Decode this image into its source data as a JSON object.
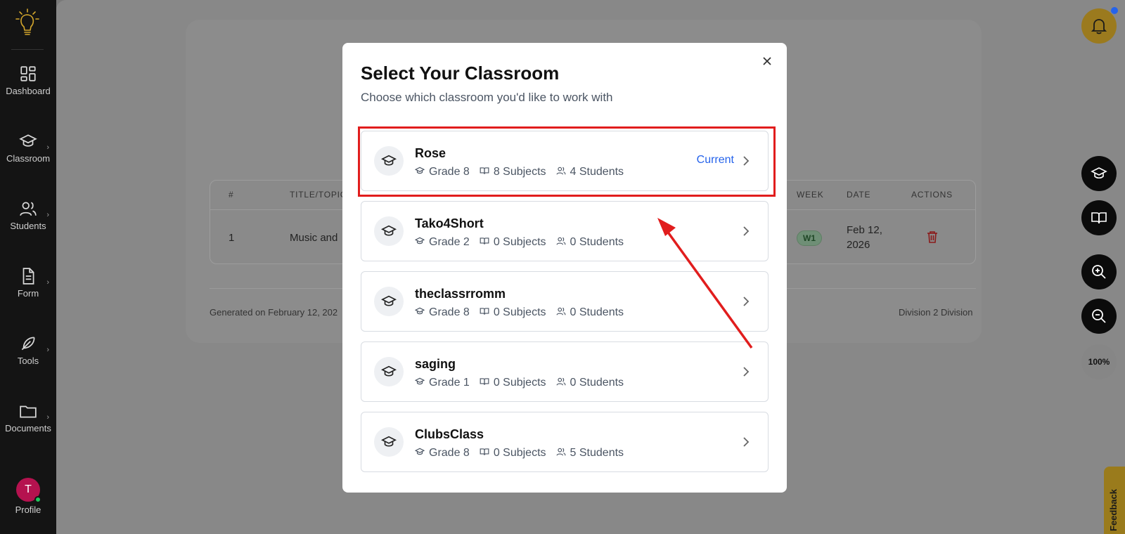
{
  "sidebar": {
    "items": [
      {
        "label": "Dashboard",
        "icon": "dashboard-icon",
        "has_submenu": false
      },
      {
        "label": "Classroom",
        "icon": "graduation-cap-icon",
        "has_submenu": true
      },
      {
        "label": "Students",
        "icon": "users-icon",
        "has_submenu": true
      },
      {
        "label": "Form",
        "icon": "document-icon",
        "has_submenu": true
      },
      {
        "label": "Tools",
        "icon": "feather-icon",
        "has_submenu": true
      },
      {
        "label": "Documents",
        "icon": "folder-icon",
        "has_submenu": true
      }
    ],
    "profile": {
      "initial": "T",
      "label": "Profile"
    }
  },
  "background": {
    "table_headers": [
      "#",
      "TITLE/TOPIC",
      "WEEK",
      "DATE",
      "ACTIONS"
    ],
    "row": {
      "num": "1",
      "title": "Music and",
      "week": "W1",
      "date_line1": "Feb 12,",
      "date_line2": "2026"
    },
    "footer_left": "Generated on February 12, 202",
    "footer_right": "Division 2 Division"
  },
  "right_controls": {
    "zoom_level": "100%",
    "feedback_label": "Feedback"
  },
  "modal": {
    "title": "Select Your Classroom",
    "subtitle": "Choose which classroom you'd like to work with",
    "current_label": "Current",
    "classrooms": [
      {
        "name": "Rose",
        "grade": "Grade 8",
        "subjects": "8 Subjects",
        "students": "4 Students",
        "current": true
      },
      {
        "name": "Tako4Short",
        "grade": "Grade 2",
        "subjects": "0 Subjects",
        "students": "0 Students",
        "current": false
      },
      {
        "name": "theclassrromm",
        "grade": "Grade 8",
        "subjects": "0 Subjects",
        "students": "0 Students",
        "current": false
      },
      {
        "name": "saging",
        "grade": "Grade 1",
        "subjects": "0 Subjects",
        "students": "0 Students",
        "current": false
      },
      {
        "name": "ClubsClass",
        "grade": "Grade 8",
        "subjects": "0 Subjects",
        "students": "5 Students",
        "current": false
      }
    ]
  },
  "colors": {
    "accent": "#2563eb",
    "highlight": "#e11d1d",
    "sidebar_bg": "#141414",
    "bell_bg": "#d4a72c"
  }
}
